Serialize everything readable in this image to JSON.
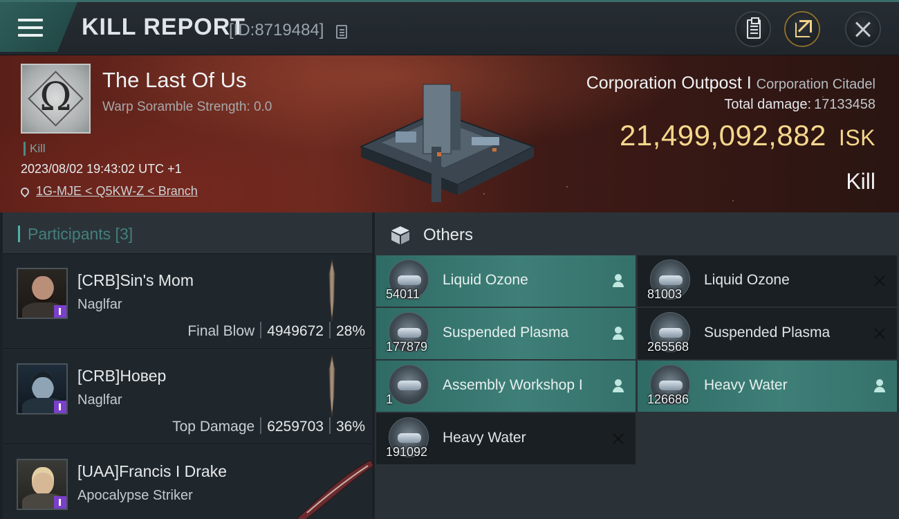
{
  "header": {
    "title": "KILL REPORT",
    "report_id": "[ID:8719484]",
    "icons": [
      "menu-icon",
      "copy-icon",
      "clipboard-icon",
      "share-icon",
      "close-icon"
    ]
  },
  "victim": {
    "name": "The Last Of Us",
    "scramble": "Warp Soramble Strength: 0.0",
    "tag": "Kill",
    "timestamp": "2023/08/02 19:43:02 UTC +1",
    "location": "1G-MJE < Q5KW-Z < Branch"
  },
  "target": {
    "name": "Corporation Outpost I",
    "class": "Corporation Citadel",
    "total_damage_label": "Total damage:",
    "total_damage": "17133458",
    "isk_value": "21,499,092,882",
    "isk_unit": "ISK",
    "result": "Kill"
  },
  "participants": {
    "title": "Participants [3]",
    "rows": [
      {
        "name": "[CRB]Sin's Mom",
        "ship": "Naglfar",
        "role": "Final Blow",
        "damage": "4949672",
        "percent": "28%"
      },
      {
        "name": "[CRB]Новер",
        "ship": "Naglfar",
        "role": "Top Damage",
        "damage": "6259703",
        "percent": "36%"
      },
      {
        "name": "[UAA]Francis I Drake",
        "ship": "Apocalypse Striker",
        "role": "",
        "damage": "",
        "percent": ""
      }
    ]
  },
  "others": {
    "title": "Others",
    "items": [
      {
        "name": "Liquid Ozone",
        "qty": "54011",
        "owned": true
      },
      {
        "name": "Liquid Ozone",
        "qty": "81003",
        "owned": false
      },
      {
        "name": "Suspended Plasma",
        "qty": "177879",
        "owned": true
      },
      {
        "name": "Suspended Plasma",
        "qty": "265568",
        "owned": false
      },
      {
        "name": "Assembly Workshop I",
        "qty": "1",
        "owned": true
      },
      {
        "name": "Heavy Water",
        "qty": "126686",
        "owned": true
      },
      {
        "name": "Heavy Water",
        "qty": "191092",
        "owned": false
      }
    ]
  },
  "colors": {
    "accent": "#3e7f78",
    "isk": "#f5d78c",
    "badge": "#7b3fcc"
  }
}
